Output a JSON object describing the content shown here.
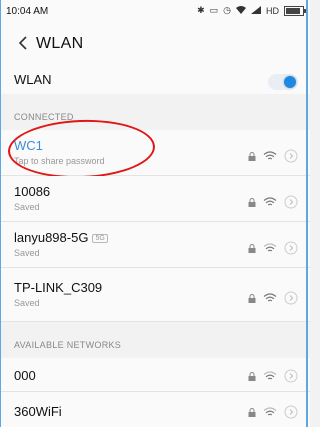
{
  "status_bar": {
    "time": "10:04 AM",
    "network_type": "HD"
  },
  "header": {
    "title": "WLAN"
  },
  "wlan_toggle": {
    "label": "WLAN",
    "enabled": true
  },
  "sections": {
    "connected": "CONNECTED",
    "available": "AVAILABLE NETWORKS"
  },
  "connected_network": {
    "name": "WC1",
    "subtitle": "Tap to share password"
  },
  "saved_networks": [
    {
      "name": "10086",
      "subtitle": "Saved",
      "badge": ""
    },
    {
      "name": "lanyu898-5G",
      "subtitle": "Saved",
      "badge": "5G"
    },
    {
      "name": "TP-LINK_C309",
      "subtitle": "Saved",
      "badge": ""
    }
  ],
  "available_networks": [
    {
      "name": "000"
    },
    {
      "name": "360WiFi"
    }
  ],
  "colors": {
    "accent": "#1e88e5",
    "connected_text": "#3b8fd6",
    "annotation": "#e01515"
  }
}
